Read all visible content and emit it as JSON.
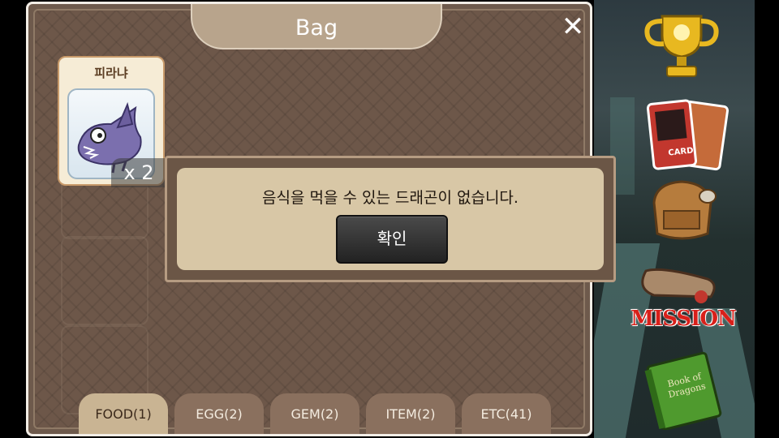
{
  "bag": {
    "title": "Bag",
    "close_label": "✕"
  },
  "item": {
    "name": "피라냐",
    "count": "x 2"
  },
  "tabs": [
    {
      "label": "FOOD(1)",
      "active": true
    },
    {
      "label": "EGG(2)",
      "active": false
    },
    {
      "label": "GEM(2)",
      "active": false
    },
    {
      "label": "ITEM(2)",
      "active": false
    },
    {
      "label": "ETC(41)",
      "active": false
    }
  ],
  "dialog": {
    "message": "음식을 먹을 수 있는 드래곤이 없습니다.",
    "confirm_label": "확인"
  },
  "side_menu": {
    "trophy_icon": "trophy-icon",
    "card_label": "CARD",
    "backpack_icon": "backpack-icon",
    "mission_label": "MISSION",
    "book_label": "Book of Dragons"
  },
  "colors": {
    "panel": "#6d5749",
    "accent_gold": "#e8b820",
    "dialog_bg": "#d8c7a6"
  }
}
